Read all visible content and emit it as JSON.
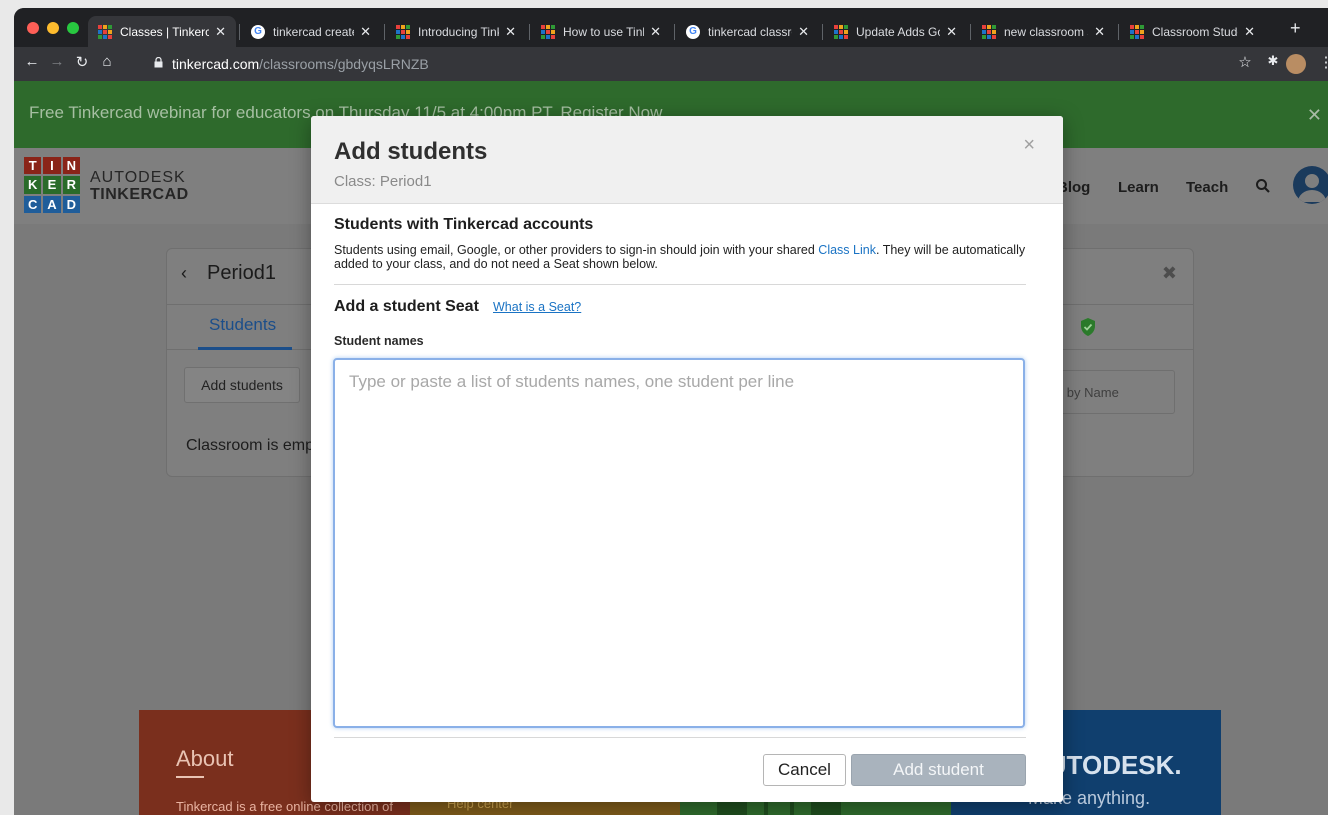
{
  "browser": {
    "tabs": [
      {
        "label": "Classes | Tinkerc",
        "favicon": "tinkercad-icon",
        "active": true
      },
      {
        "label": "tinkercad create",
        "favicon": "google-icon",
        "active": false
      },
      {
        "label": "Introducing Tink",
        "favicon": "tinkercad-icon",
        "active": false
      },
      {
        "label": "How to use Tink",
        "favicon": "tinkercad-icon",
        "active": false
      },
      {
        "label": "tinkercad classro",
        "favicon": "google-icon",
        "active": false
      },
      {
        "label": "Update Adds Go",
        "favicon": "tinkercad-icon",
        "active": false
      },
      {
        "label": "new classroom s",
        "favicon": "tinkercad-icon",
        "active": false
      },
      {
        "label": "Classroom Stude",
        "favicon": "tinkercad-icon",
        "active": false
      }
    ],
    "new_tab": "+",
    "tab_close": "✕",
    "url_host": "tinkercad.com",
    "url_path": "/classrooms/gbdyqsLRNZB"
  },
  "banner": {
    "text": "Free Tinkercad webinar for educators on Thursday 11/5 at 4:00pm PT. Register Now",
    "close": "✕"
  },
  "nav": {
    "logo_letters": [
      "T",
      "I",
      "N",
      "K",
      "E",
      "R",
      "C",
      "A",
      "D"
    ],
    "brand_line1": "AUTODESK",
    "brand_line2": "TINKERCAD",
    "links": [
      "Blog",
      "Learn",
      "Teach"
    ]
  },
  "classroom": {
    "back": "‹",
    "name": "Period1",
    "close": "✖",
    "tab_students": "Students",
    "add_students": "Add students",
    "search_placeholder": "Search by Name",
    "empty_message": "Classroom is empty"
  },
  "footer": {
    "about_title": "About",
    "about_text": "Tinkercad is a free online collection of software tools that",
    "help_center": "Help center",
    "brand": "AUTODESK.",
    "tagline": "Make anything."
  },
  "modal": {
    "title": "Add students",
    "subtitle": "Class: Period1",
    "close": "×",
    "section1_title": "Students with Tinkercad accounts",
    "section1_text_before": "Students using email, Google, or other providers to sign-in should join with your shared ",
    "section1_link": "Class Link",
    "section1_text_after": ". They will be automatically added to your class, and do not need a Seat shown below.",
    "section2_title": "Add a student Seat",
    "seat_link": "What is a Seat?",
    "names_label": "Student names",
    "names_placeholder": "Type or paste a list of students names, one student per line",
    "names_value": "",
    "cancel": "Cancel",
    "add": "Add student"
  },
  "colors": {
    "banner_bg": "#2e6a2c",
    "link_blue": "#1a73c4",
    "button_disabled": "#a9b3bd",
    "footer_about": "#c23d1e",
    "footer_help": "#d98d12",
    "footer_social": "#2f9a36",
    "footer_autodesk": "#0b5ea8"
  }
}
